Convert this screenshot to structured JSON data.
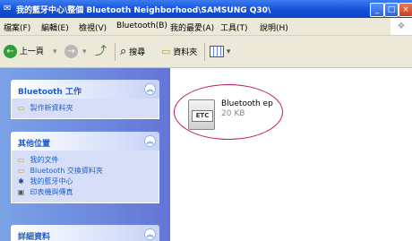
{
  "window": {
    "title": "我的藍牙中心\\整個 Bluetooth Neighborhood\\SAMSUNG Q30\\",
    "controls": {
      "minimize": "_",
      "maximize": "□",
      "close": "×"
    }
  },
  "menubar": {
    "items": [
      "檔案(F)",
      "編輯(E)",
      "檢視(V)",
      "Bluetooth(B)",
      "我的最愛(A)",
      "工具(T)",
      "說明(H)"
    ]
  },
  "toolbar": {
    "back_label": "上一頁",
    "search_label": "搜尋",
    "folders_label": "資料夾"
  },
  "sidebar": {
    "panels": [
      {
        "title": "Bluetooth 工作",
        "items": [
          "製作新資料夾"
        ]
      },
      {
        "title": "其他位置",
        "items": [
          "我的文件",
          "Bluetooth 交換資料夾",
          "我的藍牙中心",
          "印表機與傳真"
        ]
      },
      {
        "title": "詳細資料",
        "items": []
      }
    ]
  },
  "file": {
    "name": "Bluetooth ep",
    "size": "20 KB",
    "type_badge": "ETC"
  }
}
